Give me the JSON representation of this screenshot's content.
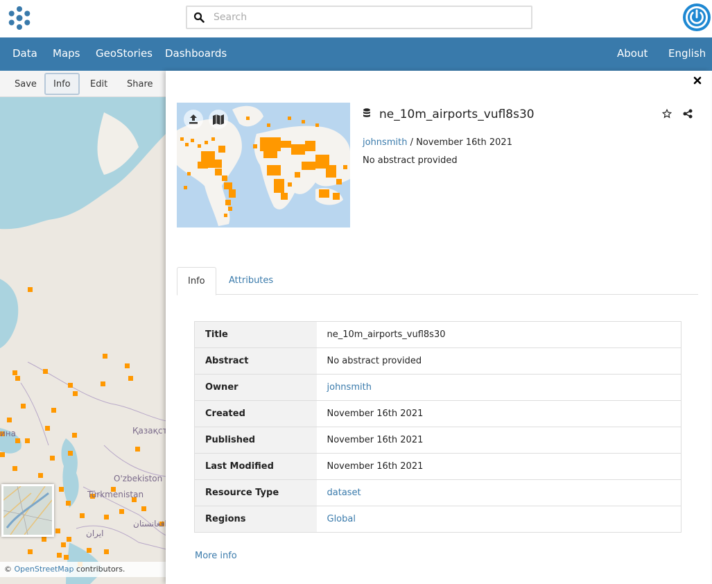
{
  "search": {
    "placeholder": "Search"
  },
  "nav": {
    "left": [
      "Data",
      "Maps",
      "GeoStories",
      "Dashboards"
    ],
    "right": [
      "About",
      "English"
    ]
  },
  "toolbar": {
    "items": [
      "Save",
      "Info",
      "Edit",
      "Share"
    ],
    "active": "Info"
  },
  "map": {
    "labels": [
      "Қазақст",
      "O'zbekiston",
      "Türkmenistan",
      "ایران",
      "افغانستان",
      "ина"
    ],
    "attribution_prefix": "©",
    "attribution_link": "OpenStreetMap",
    "attribution_suffix": "contributors."
  },
  "resource": {
    "title": "ne_10m_airports_vufl8s30",
    "owner": "johnsmith",
    "date_sep": "/",
    "date": "November 16th 2021",
    "abstract": "No abstract provided"
  },
  "tabs": [
    "Info",
    "Attributes"
  ],
  "info_table": [
    {
      "key": "Title",
      "value": "ne_10m_airports_vufl8s30",
      "link": false
    },
    {
      "key": "Abstract",
      "value": "No abstract provided",
      "link": false
    },
    {
      "key": "Owner",
      "value": "johnsmith",
      "link": true
    },
    {
      "key": "Created",
      "value": "November 16th 2021",
      "link": false
    },
    {
      "key": "Published",
      "value": "November 16th 2021",
      "link": false
    },
    {
      "key": "Last Modified",
      "value": "November 16th 2021",
      "link": false
    },
    {
      "key": "Resource Type",
      "value": "dataset",
      "link": true
    },
    {
      "key": "Regions",
      "value": "Global",
      "link": true
    }
  ],
  "more_info": "More info",
  "colors": {
    "nav": "#397aab",
    "link": "#397aab",
    "airport": "#ff9800"
  },
  "icons": [
    "logo-icon",
    "search-icon",
    "power-icon",
    "close-icon",
    "upload-icon",
    "map-icon",
    "database-icon",
    "star-icon",
    "share-icon"
  ]
}
